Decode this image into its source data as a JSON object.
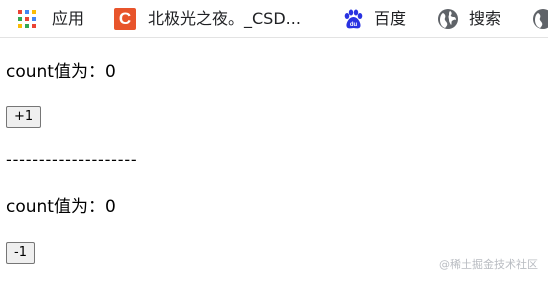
{
  "bookmarks": {
    "apps_label": "应用",
    "csdn_label": "北极光之夜。_CSD...",
    "baidu_label": "百度",
    "search_label": "搜索"
  },
  "main": {
    "first_count_text": "count值为：0",
    "increment_button": "+1",
    "divider": "--------------------",
    "second_count_text": "count值为：0",
    "decrement_button": "-1"
  },
  "watermark": "@稀土掘金技术社区",
  "colors": {
    "csdn_brand": "#e8542b",
    "baidu_brand": "#2932e1",
    "apps_grid": [
      "#ea4335",
      "#4285f4",
      "#fbbc05",
      "#34a853"
    ]
  }
}
